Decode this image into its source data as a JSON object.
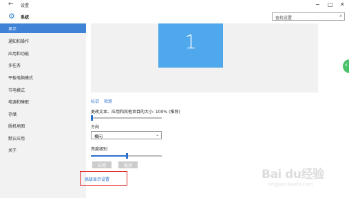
{
  "window": {
    "back_glyph": "←",
    "title": "设置",
    "min_glyph": "−",
    "max_glyph": "□",
    "close_glyph": "✕"
  },
  "header": {
    "app_name": "系统",
    "search_placeholder": "查找设置"
  },
  "sidebar": {
    "items": [
      {
        "label": "显示",
        "active": true
      },
      {
        "label": "通知和操作"
      },
      {
        "label": "应用和功能"
      },
      {
        "label": "多任务"
      },
      {
        "label": "平板电脑模式"
      },
      {
        "label": "节电模式"
      },
      {
        "label": "电源和睡眠"
      },
      {
        "label": "存储"
      },
      {
        "label": "脱机地图"
      },
      {
        "label": "默认应用"
      },
      {
        "label": "关于"
      }
    ]
  },
  "main": {
    "monitor_number": "1",
    "identify_link": "标识",
    "detect_link": "检测",
    "scale_label": "更改文本、应用和其他项目的大小: 100% (推荐)",
    "scale_value": 0.0,
    "orientation_label": "方向",
    "orientation_value": "横向",
    "brightness_label": "亮度级别",
    "brightness_value": 0.5,
    "apply_button": "应用",
    "cancel_button": "取消",
    "advanced_link": "高级显示设置"
  },
  "watermark": {
    "logo": "Bai du经验",
    "url": "jingyan.baidu.com"
  },
  "colors": {
    "accent": "#3e83d6",
    "link": "#2a6fcf",
    "monitor": "#4fa8ec",
    "highlight_box": "#e02020"
  }
}
